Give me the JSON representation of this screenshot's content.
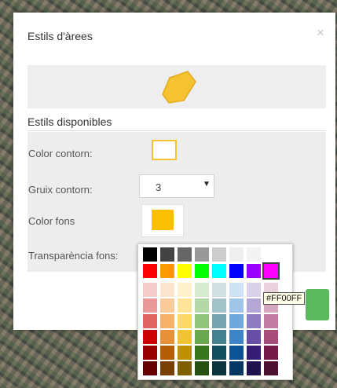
{
  "dialog": {
    "title": "Estils d'àrees",
    "close_symbol": "×",
    "section_title": "Estils disponibles"
  },
  "preview": {
    "shape_color": "#f6c232",
    "icon": "polygon-preview-icon"
  },
  "form": {
    "outline_color_label": "Color contorn:",
    "outline_color_value": "#f6c232",
    "outline_width_label": "Gruix contorn:",
    "outline_width_value": "3",
    "fill_color_label": "Color fons",
    "fill_color_value": "#fbbf04",
    "transparency_label": "Transparència fons:"
  },
  "accept_button_color": "#5cb85c",
  "palette": {
    "selected": "#FF00FF",
    "rows": [
      [
        "#000000",
        "#434343",
        "#666666",
        "#999999",
        "#cccccc",
        "#efefef",
        "#f3f3f3",
        "#ffffff"
      ],
      [
        "#ff0000",
        "#ff9900",
        "#ffff00",
        "#00ff00",
        "#00ffff",
        "#0000ff",
        "#9900ff",
        "#ff00ff"
      ],
      [
        "#f4cccc",
        "#fce5cd",
        "#fff2cc",
        "#d9ead3",
        "#d0e0e3",
        "#cfe2f3",
        "#d9d2e9",
        "#ead1dc"
      ],
      [
        "#ea9999",
        "#f9cb9c",
        "#ffe599",
        "#b6d7a8",
        "#a2c4c9",
        "#9fc5e8",
        "#b4a7d6",
        "#d5a6bd"
      ],
      [
        "#e06666",
        "#f6b26b",
        "#ffd966",
        "#93c47d",
        "#76a5af",
        "#6fa8dc",
        "#8e7cc3",
        "#c27ba0"
      ],
      [
        "#cc0000",
        "#e69138",
        "#f1c232",
        "#6aa84f",
        "#45818e",
        "#3d85c6",
        "#674ea7",
        "#a64d79"
      ],
      [
        "#990000",
        "#b45f06",
        "#bf9000",
        "#38761d",
        "#134f5c",
        "#0b5394",
        "#351c75",
        "#741b47"
      ],
      [
        "#660000",
        "#783f04",
        "#7f6000",
        "#274e13",
        "#0c343d",
        "#073763",
        "#20124d",
        "#4c1130"
      ]
    ]
  },
  "tooltip": "#FF00FF"
}
